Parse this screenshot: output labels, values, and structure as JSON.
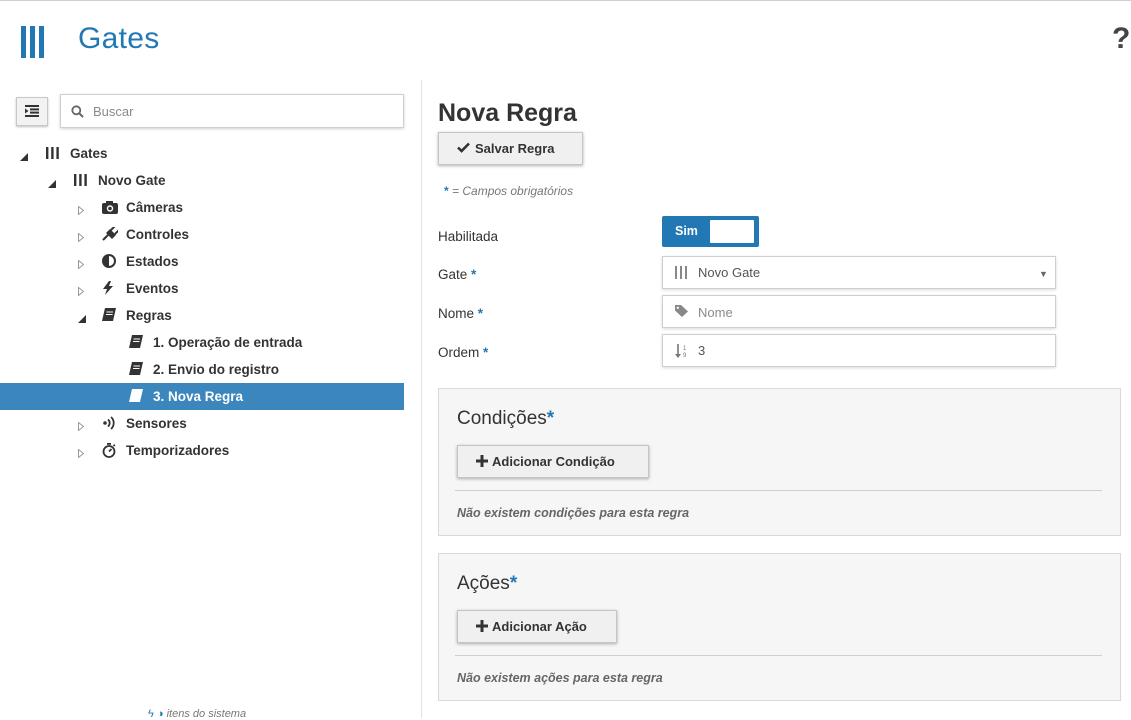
{
  "header": {
    "title": "Gates",
    "help_glyph": "?"
  },
  "sidebar": {
    "search_placeholder": "Buscar",
    "tree": [
      {
        "label": "Gates",
        "icon": "gate-icon",
        "level": 0,
        "expanded": true
      },
      {
        "label": "Novo Gate",
        "icon": "gate-icon",
        "level": 1,
        "expanded": true
      },
      {
        "label": "Câmeras",
        "icon": "camera-icon",
        "level": 2,
        "expanded": false
      },
      {
        "label": "Controles",
        "icon": "plug-icon",
        "level": 2,
        "expanded": false
      },
      {
        "label": "Estados",
        "icon": "half-circle-icon",
        "level": 2,
        "expanded": false
      },
      {
        "label": "Eventos",
        "icon": "bolt-icon",
        "level": 2,
        "expanded": false
      },
      {
        "label": "Regras",
        "icon": "book-icon",
        "level": 2,
        "expanded": true
      },
      {
        "label": "1. Operação de entrada",
        "icon": "book-icon",
        "level": 3
      },
      {
        "label": "2. Envio do registro",
        "icon": "book-icon",
        "level": 3
      },
      {
        "label": "3. Nova Regra",
        "icon": "book-icon",
        "level": 3,
        "selected": true
      },
      {
        "label": "Sensores",
        "icon": "signal-icon",
        "level": 2,
        "expanded": false
      },
      {
        "label": "Temporizadores",
        "icon": "stopwatch-icon",
        "level": 2,
        "expanded": false
      }
    ],
    "legend": "itens do sistema"
  },
  "main": {
    "title": "Nova Regra",
    "save_label": "Salvar Regra",
    "required_star": "*",
    "required_note": "= Campos obrigatórios",
    "fields": {
      "enabled_label": "Habilitada",
      "enabled_value": "Sim",
      "gate_label": "Gate",
      "gate_value": "Novo Gate",
      "name_label": "Nome",
      "name_placeholder": "Nome",
      "order_label": "Ordem",
      "order_value": "3"
    },
    "conditions": {
      "title": "Condições",
      "add_label": "Adicionar Condição",
      "empty": "Não existem condições para esta regra"
    },
    "actions": {
      "title": "Ações",
      "add_label": "Adicionar Ação",
      "empty": "Não existem ações para esta regra"
    }
  },
  "colors": {
    "accent": "#2178b5",
    "selected_row": "#3b86bc"
  }
}
